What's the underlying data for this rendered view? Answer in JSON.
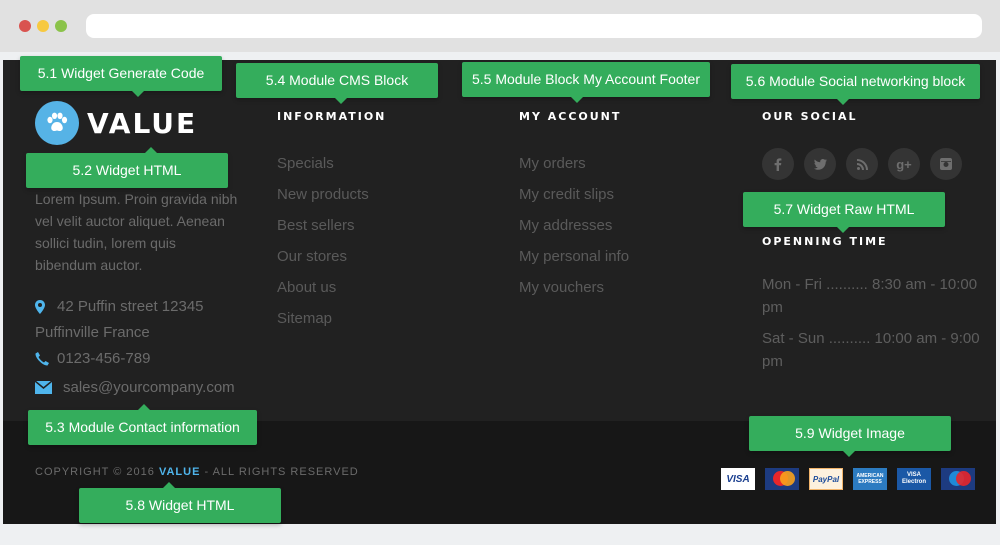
{
  "browser": {
    "window_controls": [
      "close",
      "minimize",
      "maximize"
    ],
    "address": ""
  },
  "logo": {
    "text": "VALUE",
    "icon": "paw-icon"
  },
  "about": {
    "text": "Lorem Ipsum. Proin gravida nibh vel velit auctor aliquet. Aenean sollici tudin, lorem quis bibendum auctor."
  },
  "contact": {
    "address_line1": "42 Puffin street 12345",
    "address_line2": "Puffinville France",
    "phone": "0123-456-789",
    "email": "sales@yourcompany.com"
  },
  "information": {
    "title": "INFORMATION",
    "links": [
      "Specials",
      "New products",
      "Best sellers",
      "Our stores",
      "About us",
      "Sitemap"
    ]
  },
  "account": {
    "title": "MY ACCOUNT",
    "links": [
      "My orders",
      "My credit slips",
      "My addresses",
      "My personal info",
      "My vouchers"
    ]
  },
  "social": {
    "title": "OUR SOCIAL",
    "icons": [
      {
        "name": "facebook-icon",
        "glyph": "f"
      },
      {
        "name": "twitter-icon",
        "glyph": "t"
      },
      {
        "name": "rss-icon",
        "glyph": "◢"
      },
      {
        "name": "google-plus-icon",
        "glyph": "g+"
      },
      {
        "name": "instagram-icon",
        "glyph": "◙"
      }
    ]
  },
  "opening": {
    "title": "OPENNING TIME",
    "weekday": "Mon - Fri .......... 8:30 am - 10:00 pm",
    "weekend": "Sat - Sun .......... 10:00 am - 9:00 pm"
  },
  "copyright": {
    "prefix": "COPYRIGHT © 2016",
    "brand": "VALUE",
    "suffix": "- ALL RIGHTS RESERVED"
  },
  "payments": {
    "visa": "VISA",
    "mastercard": "MasterCard",
    "paypal": "PayPal",
    "amex": "AMERICAN EXPRESS",
    "electron_top": "VISA",
    "electron_bottom": "Electron",
    "maestro": "Maestro"
  },
  "callouts": {
    "c51": "5.1 Widget Generate Code",
    "c52": "5.2 Widget HTML",
    "c53": "5.3 Module Contact information",
    "c54": "5.4 Module CMS Block",
    "c55": "5.5 Module Block My Account Footer",
    "c56": "5.6 Module Social networking block",
    "c57": "5.7 Widget Raw HTML",
    "c58": "5.8 Widget HTML",
    "c59": "5.9 Widget Image"
  },
  "colors": {
    "accent_green": "#34ad5c",
    "brand_blue": "#4fb5ec",
    "footer_bg": "#212121",
    "footer_bottom_bg": "#171717"
  }
}
